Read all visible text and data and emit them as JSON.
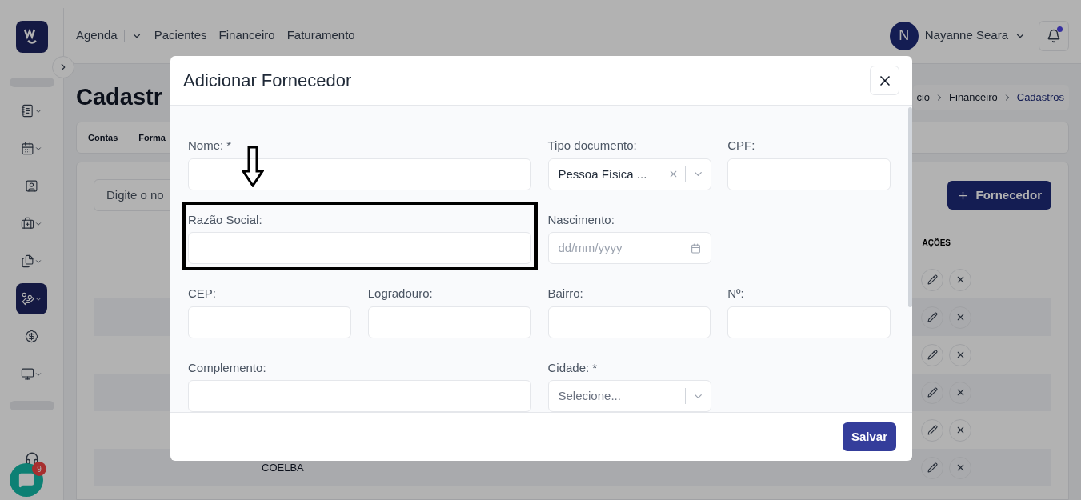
{
  "sidebar": {
    "items": [
      {
        "expandable": true,
        "selected": false
      },
      {
        "expandable": true,
        "selected": false
      },
      {
        "expandable": false,
        "selected": false
      },
      {
        "expandable": true,
        "selected": false
      },
      {
        "expandable": true,
        "selected": false
      },
      {
        "expandable": true,
        "selected": true
      },
      {
        "expandable": false,
        "selected": false
      },
      {
        "expandable": true,
        "selected": false
      }
    ],
    "chat_badge": "9"
  },
  "nav": [
    {
      "label": "Agenda",
      "dropdown": true
    },
    {
      "label": "Pacientes",
      "dropdown": false
    },
    {
      "label": "Financeiro",
      "dropdown": false
    },
    {
      "label": "Faturamento",
      "dropdown": false
    }
  ],
  "user": {
    "initial": "N",
    "name": "Nayanne Seara",
    "notification": true
  },
  "page": {
    "title": "Cadastr",
    "breadcrumb": [
      {
        "label": "cio",
        "current": false
      },
      {
        "label": "Financeiro",
        "current": false
      },
      {
        "label": "Cadastros",
        "current": true
      }
    ],
    "tabs": [
      {
        "label": "Contas"
      },
      {
        "label": "Forma"
      }
    ],
    "search_placeholder": "Digite o no",
    "add_button": "Fornecedor",
    "table": {
      "actions_header": "AÇÕES",
      "rows": [
        {},
        {},
        {},
        {},
        {},
        {
          "name": "COELBA"
        }
      ]
    }
  },
  "modal": {
    "title": "Adicionar Fornecedor",
    "save": "Salvar",
    "rows": [
      {
        "fields": [
          {
            "label": "Nome: *",
            "kind": "text",
            "wide": true
          },
          {
            "label": "Tipo documento:",
            "kind": "select",
            "value": "Pessoa Física ...",
            "clearable": true
          },
          {
            "label": "CPF:",
            "kind": "text",
            "wide": false
          }
        ]
      },
      {
        "fields": [
          {
            "label": "Razão Social:",
            "kind": "text",
            "wide": true,
            "highlighted": true
          },
          {
            "label": "Nascimento:",
            "kind": "date",
            "placeholder": "dd/mm/yyyy"
          }
        ]
      },
      {
        "fields": [
          {
            "label": "CEP:",
            "kind": "text",
            "wide": false
          },
          {
            "label": "Logradouro:",
            "kind": "text",
            "wide": false
          },
          {
            "label": "Bairro:",
            "kind": "text",
            "wide": false
          },
          {
            "label": "Nº:",
            "kind": "text",
            "wide": false
          }
        ]
      },
      {
        "fields": [
          {
            "label": "Complemento:",
            "kind": "text",
            "wide": true
          },
          {
            "label": "Cidade: *",
            "kind": "select",
            "placeholder": "Selecione...",
            "clearable": false
          }
        ]
      }
    ]
  }
}
